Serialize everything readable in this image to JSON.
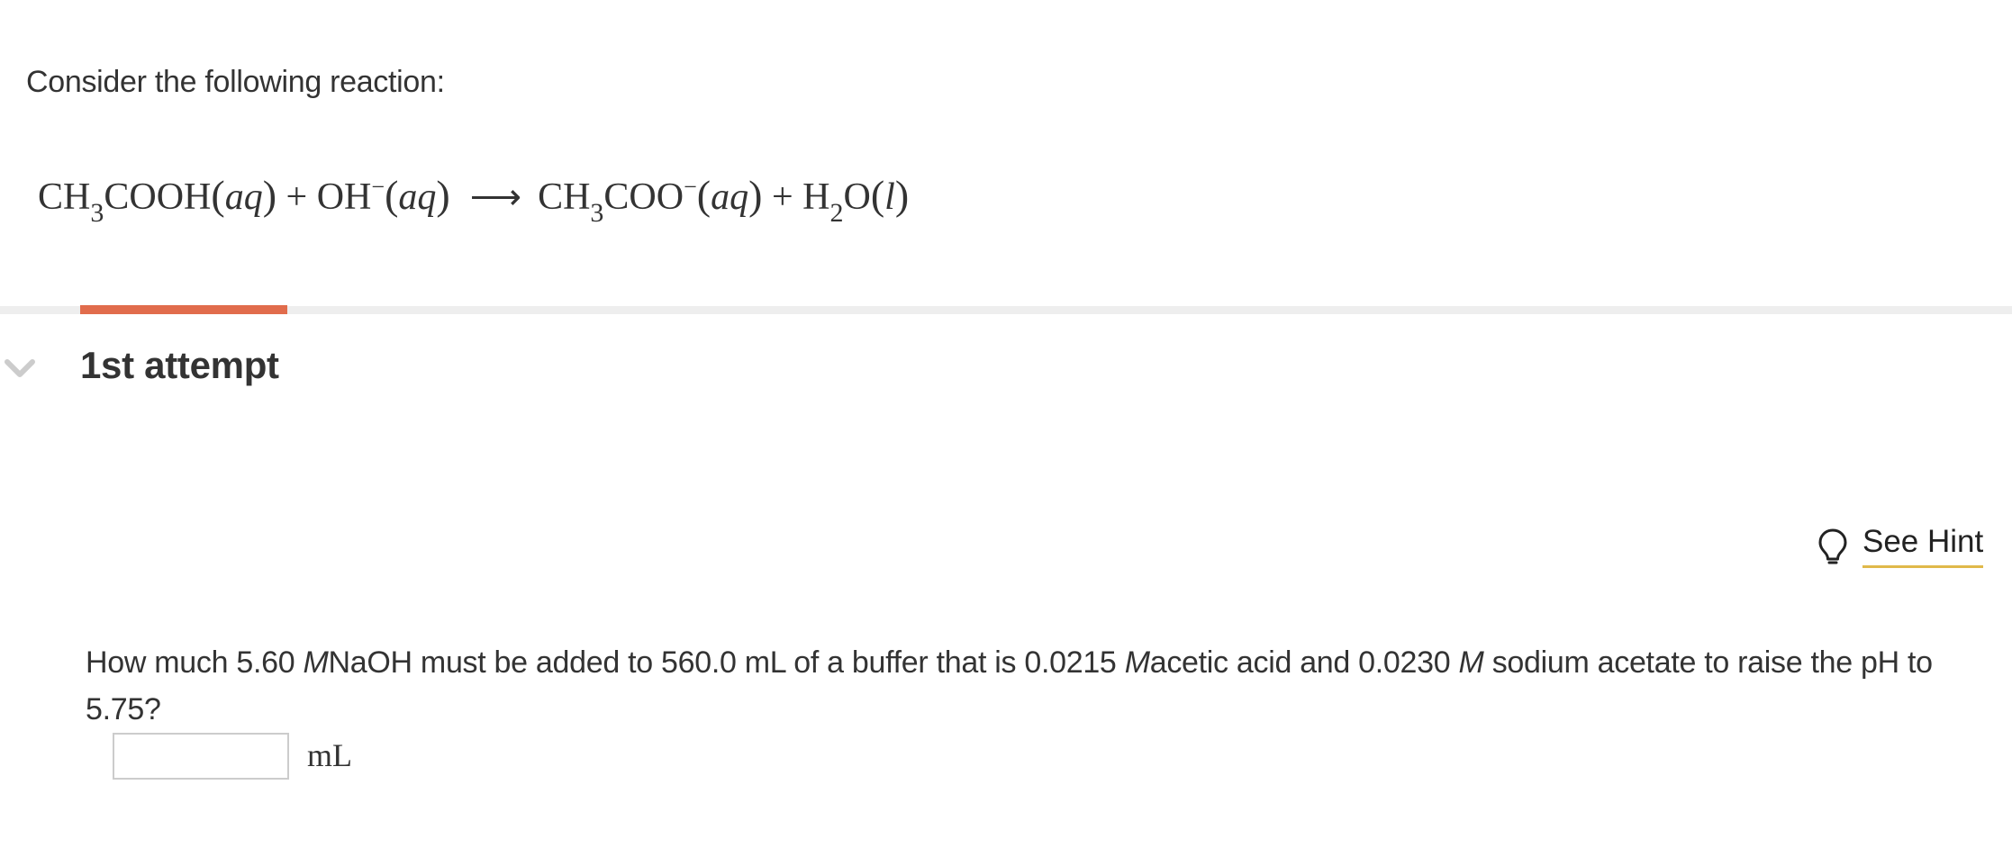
{
  "intro_text": "Consider the following reaction:",
  "reaction": {
    "r1_a": "CH",
    "r1_sub": "3",
    "r1_b": "COOH",
    "r1_state": "aq",
    "plus1": "+",
    "r2_a": "OH",
    "r2_sup": "−",
    "r2_state": "aq",
    "arrow": "⟶",
    "p1_a": "CH",
    "p1_sub": "3",
    "p1_b": "COO",
    "p1_sup": "−",
    "p1_state": "aq",
    "plus2": "+",
    "p2_a": "H",
    "p2_sub": "2",
    "p2_b": "O",
    "p2_state": "l"
  },
  "progress": {
    "fraction": 0.103,
    "fill_color": "#e16c4c",
    "track_color": "#eeeeee"
  },
  "attempt": {
    "icon": "chevron-down-icon",
    "title": "1st attempt"
  },
  "hint": {
    "icon": "lightbulb-icon",
    "label": "See Hint",
    "underline_color": "#e0b94a"
  },
  "question": {
    "p1": "How much 5.60 ",
    "m1": "M",
    "p2": "NaOH must be added to 560.0 mL of a buffer that is 0.0215 ",
    "m2": "M",
    "p3": "acetic acid and 0.0230 ",
    "m3": "M",
    "p4": " sodium acetate to raise the pH to 5.75?"
  },
  "answer": {
    "value": "",
    "placeholder": "",
    "unit": "mL"
  }
}
